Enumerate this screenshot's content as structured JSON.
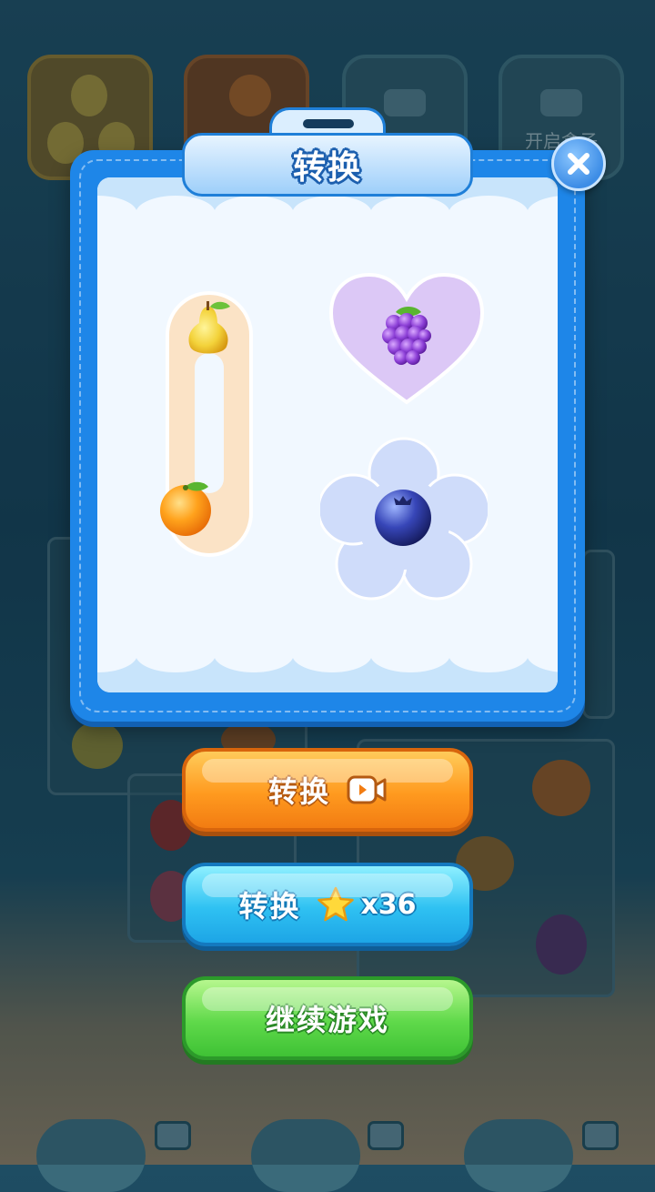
{
  "background": {
    "slot_label": "开启盒子"
  },
  "dialog": {
    "title": "转换",
    "close_icon": "close-icon",
    "items": [
      {
        "name": "pear-icon"
      },
      {
        "name": "orange-icon"
      },
      {
        "name": "grape-icon"
      },
      {
        "name": "blueberry-icon"
      }
    ]
  },
  "buttons": {
    "video_convert_label": "转换",
    "star_convert_label": "转换",
    "star_cost": "x36",
    "continue_label": "继续游戏"
  },
  "colors": {
    "dialog_blue": "#1e86e8",
    "orange_button": "#ff9a1f",
    "blue_button": "#2fc1f2",
    "green_button": "#5fd94a"
  }
}
